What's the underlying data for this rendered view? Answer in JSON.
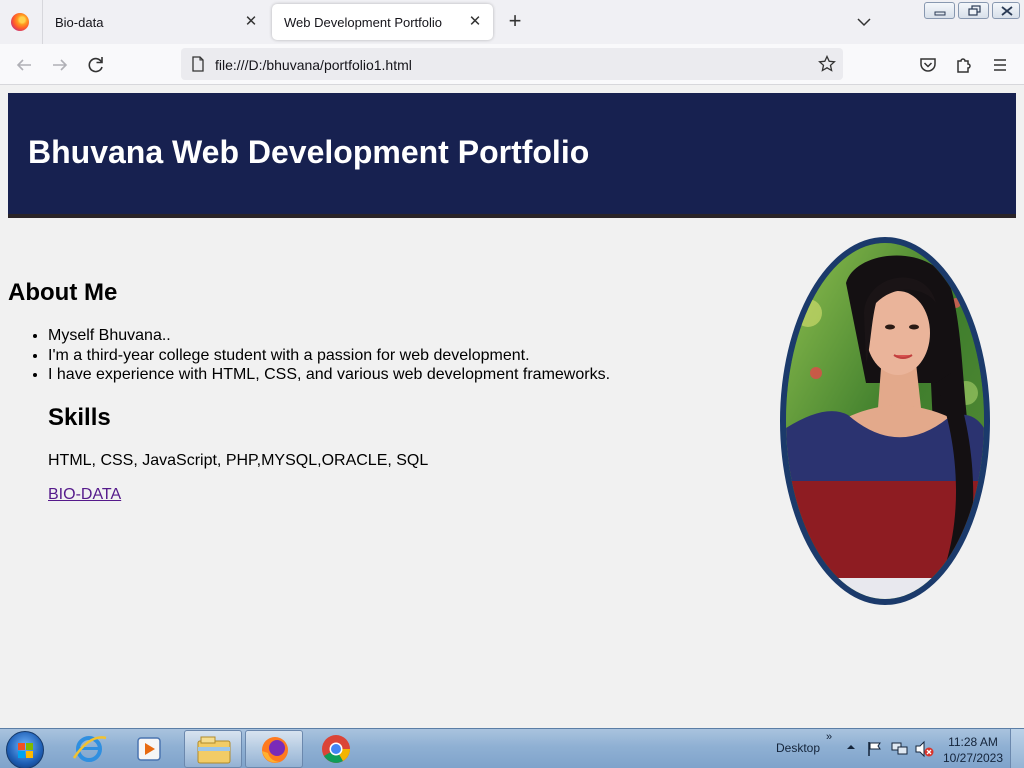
{
  "browser": {
    "tabs": [
      {
        "label": "Bio-data"
      },
      {
        "label": "Web Development Portfolio"
      }
    ],
    "url": "file:///D:/bhuvana/portfolio1.html"
  },
  "page": {
    "header_title": "Bhuvana Web Development Portfolio",
    "about": {
      "heading": "About Me",
      "items": [
        "Myself Bhuvana..",
        "I'm a third-year college student with a passion for web development.",
        "I have experience with HTML, CSS, and various web development frameworks."
      ]
    },
    "skills": {
      "heading": "Skills",
      "text": "HTML, CSS, JavaScript, PHP,MYSQL,ORACLE, SQL"
    },
    "link_label": "BIO-DATA",
    "colors": {
      "header_bg": "#172150",
      "photo_border": "#1b3a6b",
      "visited_link": "#551a8b"
    }
  },
  "taskbar": {
    "desktop_label": "Desktop",
    "time": "11:28 AM",
    "date": "10/27/2023",
    "pinned": [
      "internet-explorer-icon",
      "media-player-icon",
      "file-explorer-icon",
      "firefox-icon",
      "chrome-icon"
    ]
  }
}
